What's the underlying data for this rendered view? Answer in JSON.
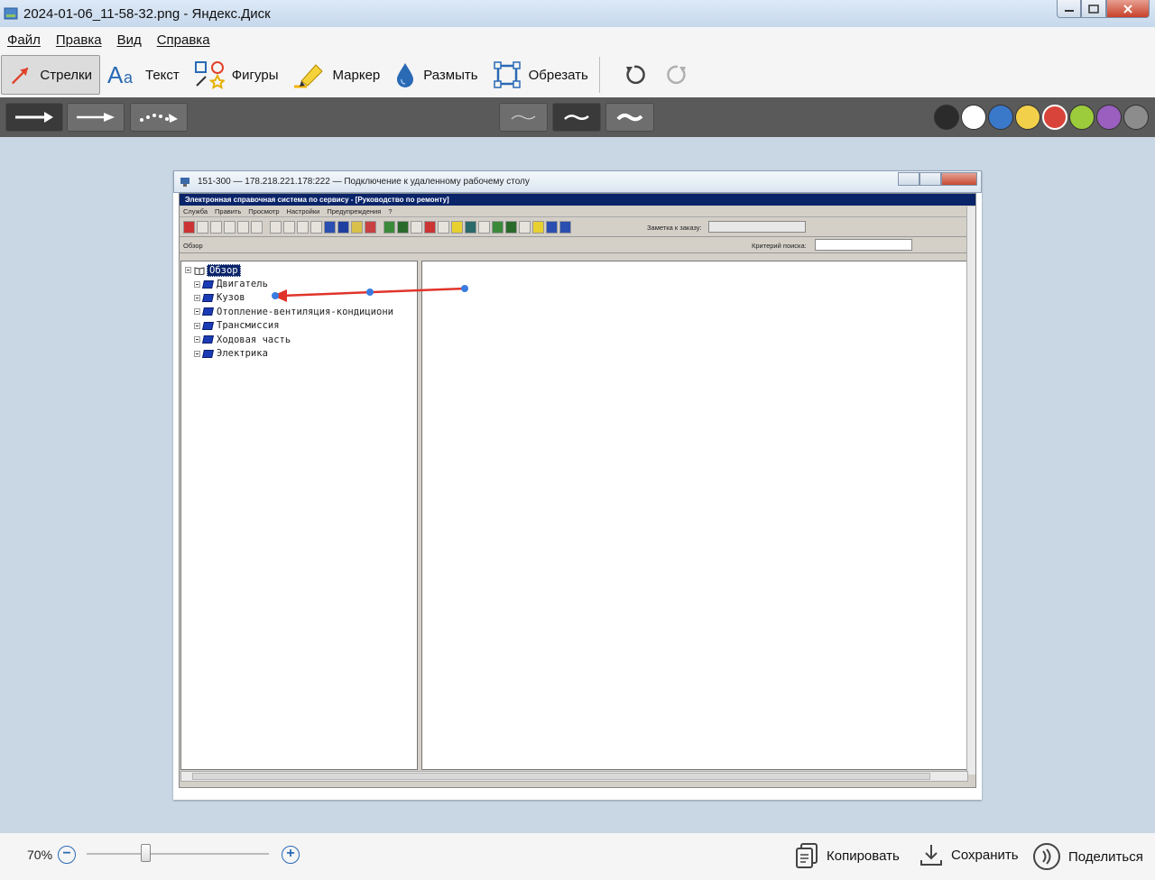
{
  "window": {
    "title": "2024-01-06_11-58-32.png - Яндекс.Диск"
  },
  "menu": [
    "Файл",
    "Правка",
    "Вид",
    "Справка"
  ],
  "toolbar": {
    "tools": [
      {
        "label": "Стрелки",
        "icon": "arrow-tool-icon",
        "active": true
      },
      {
        "label": "Текст",
        "icon": "text-tool-icon"
      },
      {
        "label": "Фигуры",
        "icon": "shapes-tool-icon"
      },
      {
        "label": "Маркер",
        "icon": "marker-tool-icon"
      },
      {
        "label": "Размыть",
        "icon": "blur-tool-icon"
      },
      {
        "label": "Обрезать",
        "icon": "crop-tool-icon"
      }
    ],
    "undo_icon": "undo-icon",
    "redo_icon": "redo-icon"
  },
  "options": {
    "arrow_styles": [
      "arrow-style-solid",
      "arrow-style-thin",
      "arrow-style-dotted"
    ],
    "thickness": [
      "thin",
      "medium",
      "thick"
    ],
    "selected_thickness": "medium",
    "colors": [
      "#2b2b2b",
      "#ffffff",
      "#3a78c9",
      "#f2d04a",
      "#d9443a",
      "#9ccc3c",
      "#9a5fbf",
      "#8c8c8c"
    ],
    "selected_color": "#d9443a"
  },
  "screenshot": {
    "rdp_title": "151-300 — 178.218.221.178:222 — Подключение к удаленному рабочему столу",
    "app_title": "Электронная справочная система по сервису - [Руководство по ремонту]",
    "app_menu": [
      "Служба",
      "Править",
      "Просмотр",
      "Настройки",
      "Предупреждения",
      "?"
    ],
    "order_note_label": "Заметка к заказу:",
    "overview_label": "Обзор",
    "search_label": "Критерий поиска:",
    "tree_root": "Обзор",
    "tree_items": [
      "Двигатель",
      "Кузов",
      "Отопление-вентиляция-кондициони",
      "Трансмиссия",
      "Ходовая часть",
      "Электрика"
    ]
  },
  "bottom": {
    "zoom": "70%",
    "zoom_value": 0.3,
    "copy": "Копировать",
    "save": "Сохранить",
    "share": "Поделиться"
  }
}
